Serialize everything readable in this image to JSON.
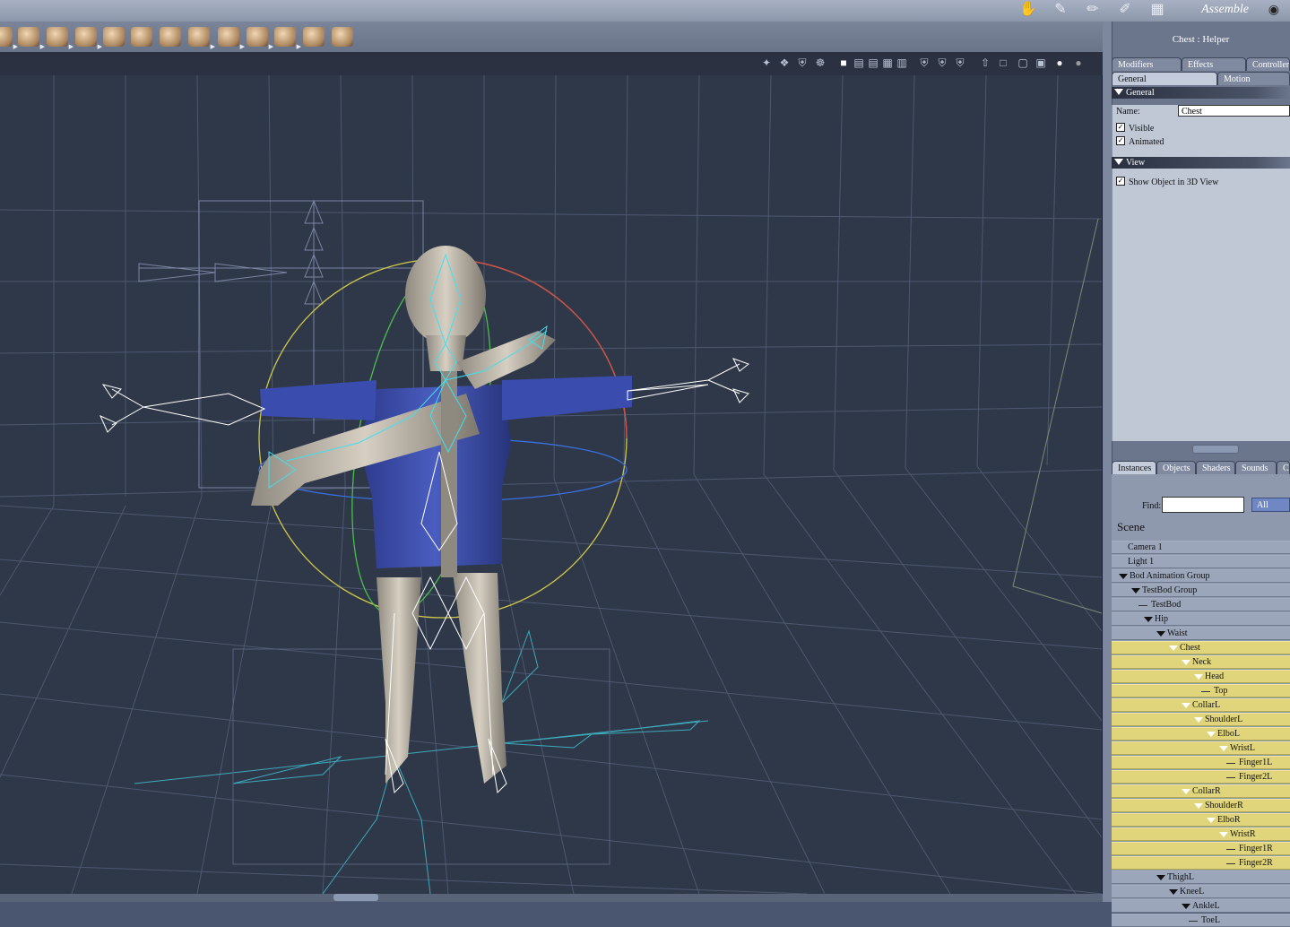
{
  "header": {
    "room_label": "Assemble",
    "room_icons": [
      "hand-icon",
      "character-icon",
      "paintbrush-icon",
      "brush-icon",
      "assemble-icon"
    ],
    "eye_icon": "eye-icon"
  },
  "toolbar": {
    "tools": [
      "lake-tool",
      "hands-tool",
      "rocks-tool",
      "grass-tool",
      "house-tool",
      "bowl-tool",
      "shoe-tool",
      "hammer-tool",
      "spider-tool",
      "joint-tool",
      "ring-tool",
      "bone-tool"
    ]
  },
  "viewport_toolbar": {
    "icons": [
      "select-icon",
      "pivot-icon",
      "move-icon",
      "rotate-icon",
      "single-view-icon",
      "two-views-icon",
      "three-views-icon",
      "four-views-icon",
      "split-view-icon",
      "shield-a-icon",
      "shield-b-icon",
      "shield-c-icon",
      "arrow-up-icon",
      "frame-icon",
      "box-wire-icon",
      "box-solid-icon",
      "sphere-smooth-icon",
      "sphere-shaded-icon"
    ]
  },
  "properties": {
    "title": "Chest : Helper",
    "tabs_top": [
      "Modifiers",
      "Effects",
      "Controllers"
    ],
    "tabs_bottom": [
      "General",
      "Motion"
    ],
    "general_section": "General",
    "name_label": "Name:",
    "name_value": "Chest",
    "visible_label": "Visible",
    "visible_checked": true,
    "animated_label": "Animated",
    "animated_checked": true,
    "view_section": "View",
    "show3d_label": "Show Object in 3D View",
    "show3d_checked": true
  },
  "library": {
    "tabs": [
      "Instances",
      "Objects",
      "Shaders",
      "Sounds",
      "Cl"
    ],
    "find_label": "Find:",
    "find_value": "",
    "filter_value": "All",
    "scene_title": "Scene",
    "tree": [
      {
        "label": "Camera 1",
        "depth": 0,
        "arrow": false,
        "selected": false
      },
      {
        "label": "Light 1",
        "depth": 0,
        "arrow": false,
        "selected": false
      },
      {
        "label": "Bod Animation Group",
        "depth": 0,
        "arrow": true,
        "selected": false
      },
      {
        "label": "TestBod Group",
        "depth": 1,
        "arrow": true,
        "selected": false
      },
      {
        "label": "TestBod",
        "depth": 2,
        "arrow": false,
        "selected": false
      },
      {
        "label": "Hip",
        "depth": 2,
        "arrow": true,
        "selected": false
      },
      {
        "label": "Waist",
        "depth": 3,
        "arrow": true,
        "selected": false
      },
      {
        "label": "Chest",
        "depth": 4,
        "arrow": true,
        "selected": true
      },
      {
        "label": "Neck",
        "depth": 5,
        "arrow": true,
        "selected": true
      },
      {
        "label": "Head",
        "depth": 6,
        "arrow": true,
        "selected": true
      },
      {
        "label": "Top",
        "depth": 7,
        "arrow": false,
        "selected": true
      },
      {
        "label": "CollarL",
        "depth": 5,
        "arrow": true,
        "selected": true
      },
      {
        "label": "ShoulderL",
        "depth": 6,
        "arrow": true,
        "selected": true
      },
      {
        "label": "ElboL",
        "depth": 7,
        "arrow": true,
        "selected": true
      },
      {
        "label": "WristL",
        "depth": 8,
        "arrow": true,
        "selected": true
      },
      {
        "label": "Finger1L",
        "depth": 9,
        "arrow": false,
        "selected": true
      },
      {
        "label": "Finger2L",
        "depth": 9,
        "arrow": false,
        "selected": true
      },
      {
        "label": "CollarR",
        "depth": 5,
        "arrow": true,
        "selected": true
      },
      {
        "label": "ShoulderR",
        "depth": 6,
        "arrow": true,
        "selected": true
      },
      {
        "label": "ElboR",
        "depth": 7,
        "arrow": true,
        "selected": true
      },
      {
        "label": "WristR",
        "depth": 8,
        "arrow": true,
        "selected": true
      },
      {
        "label": "Finger1R",
        "depth": 9,
        "arrow": false,
        "selected": true
      },
      {
        "label": "Finger2R",
        "depth": 9,
        "arrow": false,
        "selected": true
      },
      {
        "label": "ThighL",
        "depth": 3,
        "arrow": true,
        "selected": false
      },
      {
        "label": "KneeL",
        "depth": 4,
        "arrow": true,
        "selected": false
      },
      {
        "label": "AnkleL",
        "depth": 5,
        "arrow": true,
        "selected": false
      },
      {
        "label": "ToeL",
        "depth": 6,
        "arrow": false,
        "selected": false
      }
    ]
  },
  "colors": {
    "selection": "#e0d57a",
    "viewport_bg": "#2f3848",
    "panel_bg": "#6b768c",
    "filter_blue": "#6f88c3"
  }
}
